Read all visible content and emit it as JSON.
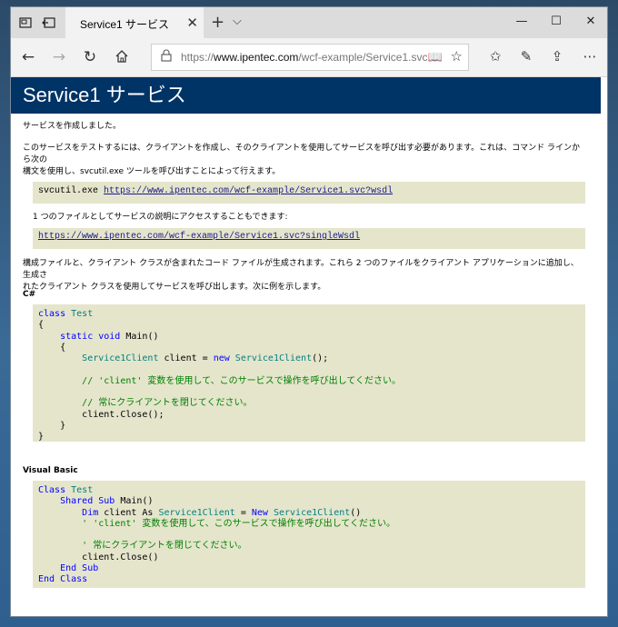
{
  "browser": {
    "tab_title": "Service1 サービス",
    "url_prefix": "https://",
    "url_domain": "www.ipentec.com",
    "url_path": "/wcf-example/Service1.svc"
  },
  "page": {
    "heading": "Service1 サービス",
    "created": "サービスを作成しました。",
    "intro1": "このサービスをテストするには、クライアントを作成し、そのクライアントを使用してサービスを呼び出す必要があります。これは、コマンド ラインから次の",
    "intro2": "構文を使用し、svcutil.exe ツールを呼び出すことによって行えます。",
    "svcutil_cmd": "svcutil.exe",
    "wsdl_url": "https://www.ipentec.com/wcf-example/Service1.svc?wsdl",
    "single_file_note": "1 つのファイルとしてサービスの説明にアクセスすることもできます:",
    "single_wsdl_url": "https://www.ipentec.com/wcf-example/Service1.svc?singleWsdl",
    "gen1": "構成ファイルと、クライアント クラスが含まれたコード ファイルが生成されます。これら 2 つのファイルをクライアント アプリケーションに追加し、生成さ",
    "gen2": "れたクライアント クラスを使用してサービスを呼び出します。次に例を示します。",
    "cs_label": "C#",
    "vb_label": "Visual Basic"
  },
  "csharp": {
    "l1_kw": "class",
    "l1_ty": "Test",
    "l2": "{",
    "l3_kw1": "static",
    "l3_kw2": "void",
    "l3_rest": "Main()",
    "l4": "{",
    "l5_ty1": "Service1Client",
    "l5_mid": "client =",
    "l5_kw": "new",
    "l5_ty2": "Service1Client",
    "l5_end": "();",
    "l6_cm": "// 'client' 変数を使用して、このサービスで操作を呼び出してください。",
    "l7_cm": "// 常にクライアントを閉じてください。",
    "l8": "client.Close();",
    "l9": "}",
    "l10": "}"
  },
  "vb": {
    "l1_kw": "Class",
    "l1_ty": "Test",
    "l2_kw": "Shared Sub",
    "l2_rest": "Main()",
    "l3_kw1": "Dim",
    "l3_mid1": "client As",
    "l3_ty1": "Service1Client",
    "l3_mid2": "=",
    "l3_kw2": "New",
    "l3_ty2": "Service1Client",
    "l3_end": "()",
    "l4_cm": "' 'client' 変数を使用して、このサービスで操作を呼び出してください。",
    "l5_cm": "' 常にクライアントを閉じてください。",
    "l6": "client.Close()",
    "l7_kw": "End Sub",
    "l8_kw": "End Class"
  },
  "colors": {
    "heading_bg": "#003366",
    "code_bg": "#e5e5cc",
    "keyword": "#0000ff",
    "type": "#008080",
    "comment": "#008000"
  }
}
